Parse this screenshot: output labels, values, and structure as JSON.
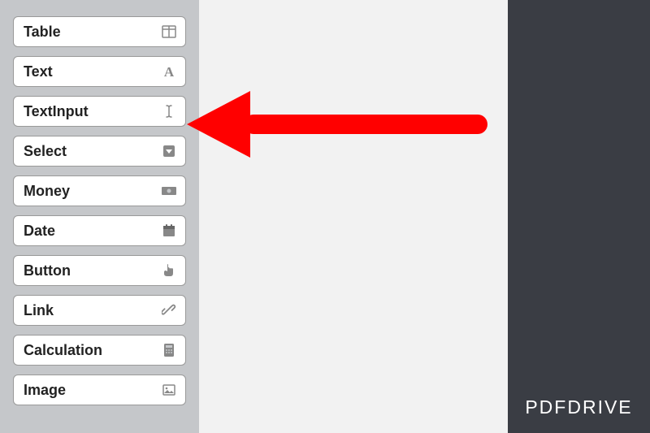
{
  "sidebar": {
    "items": [
      {
        "label": "Table",
        "icon": "table-icon"
      },
      {
        "label": "Text",
        "icon": "text-icon"
      },
      {
        "label": "TextInput",
        "icon": "text-cursor-icon"
      },
      {
        "label": "Select",
        "icon": "dropdown-icon"
      },
      {
        "label": "Money",
        "icon": "money-icon"
      },
      {
        "label": "Date",
        "icon": "calendar-icon"
      },
      {
        "label": "Button",
        "icon": "pointer-icon"
      },
      {
        "label": "Link",
        "icon": "link-icon"
      },
      {
        "label": "Calculation",
        "icon": "calculator-icon"
      },
      {
        "label": "Image",
        "icon": "image-icon"
      }
    ]
  },
  "annotation": {
    "arrow_target_index": 2,
    "arrow_color": "#ff0000"
  },
  "brand": {
    "name": "PDFDRIVE"
  }
}
